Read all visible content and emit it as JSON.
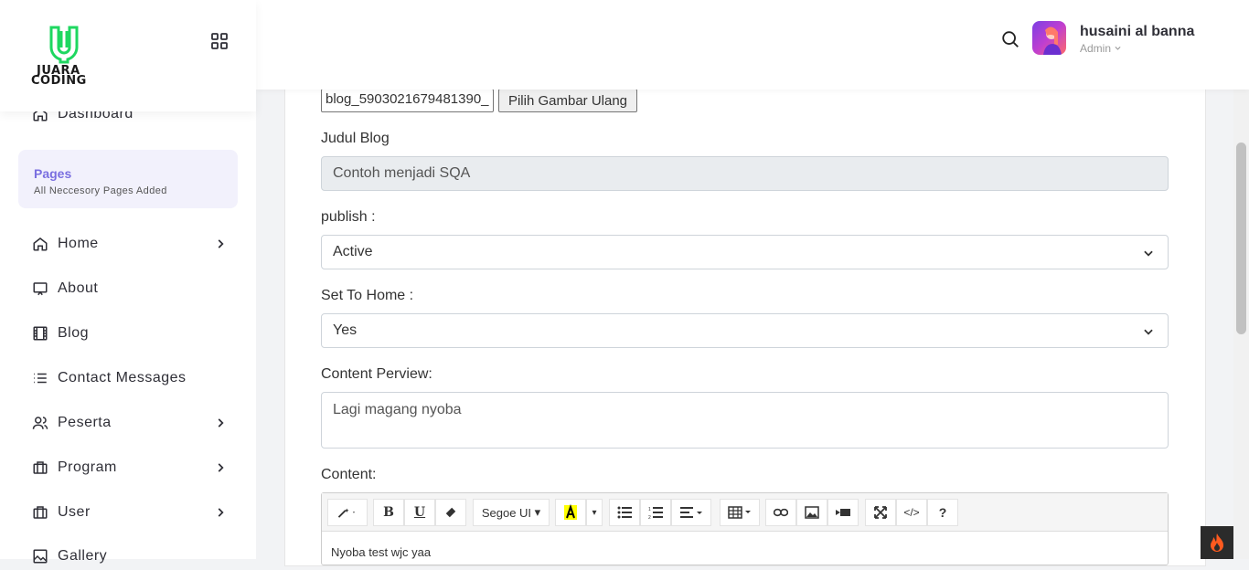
{
  "brand": {
    "line1": "JUARA",
    "line2": "CODING",
    "color": "#1ed760"
  },
  "sidebar": {
    "dashboard": "Dashboard",
    "pages_card": {
      "title": "Pages",
      "subtitle": "All Neccesory Pages Added"
    },
    "items": [
      {
        "label": "Home",
        "icon": "home-icon",
        "has_children": true
      },
      {
        "label": "About",
        "icon": "monitor-icon",
        "has_children": false
      },
      {
        "label": "Blog",
        "icon": "film-icon",
        "has_children": false
      },
      {
        "label": "Contact Messages",
        "icon": "list-icon",
        "has_children": false
      },
      {
        "label": "Peserta",
        "icon": "users-icon",
        "has_children": true
      },
      {
        "label": "Program",
        "icon": "briefcase-icon",
        "has_children": true
      },
      {
        "label": "User",
        "icon": "briefcase-icon",
        "has_children": true
      },
      {
        "label": "Gallery",
        "icon": "image-icon",
        "has_children": false
      }
    ]
  },
  "header": {
    "user_name": "husaini al banna",
    "user_role": "Admin"
  },
  "form": {
    "file_name": "blog_5903021679481390_",
    "file_button": "Pilih Gambar Ulang",
    "judul_label": "Judul Blog",
    "judul_value": "Contoh menjadi SQA",
    "publish_label": "publish :",
    "publish_value": "Active",
    "home_label": "Set To Home :",
    "home_value": "Yes",
    "preview_label": "Content Perview:",
    "preview_value": "Lagi magang nyoba",
    "content_label": "Content:",
    "font_name": "Segoe UI",
    "content_text": "Nyoba test wjc yaa"
  },
  "colors": {
    "accent": "#7a6fe0",
    "brand": "#1ed760"
  }
}
